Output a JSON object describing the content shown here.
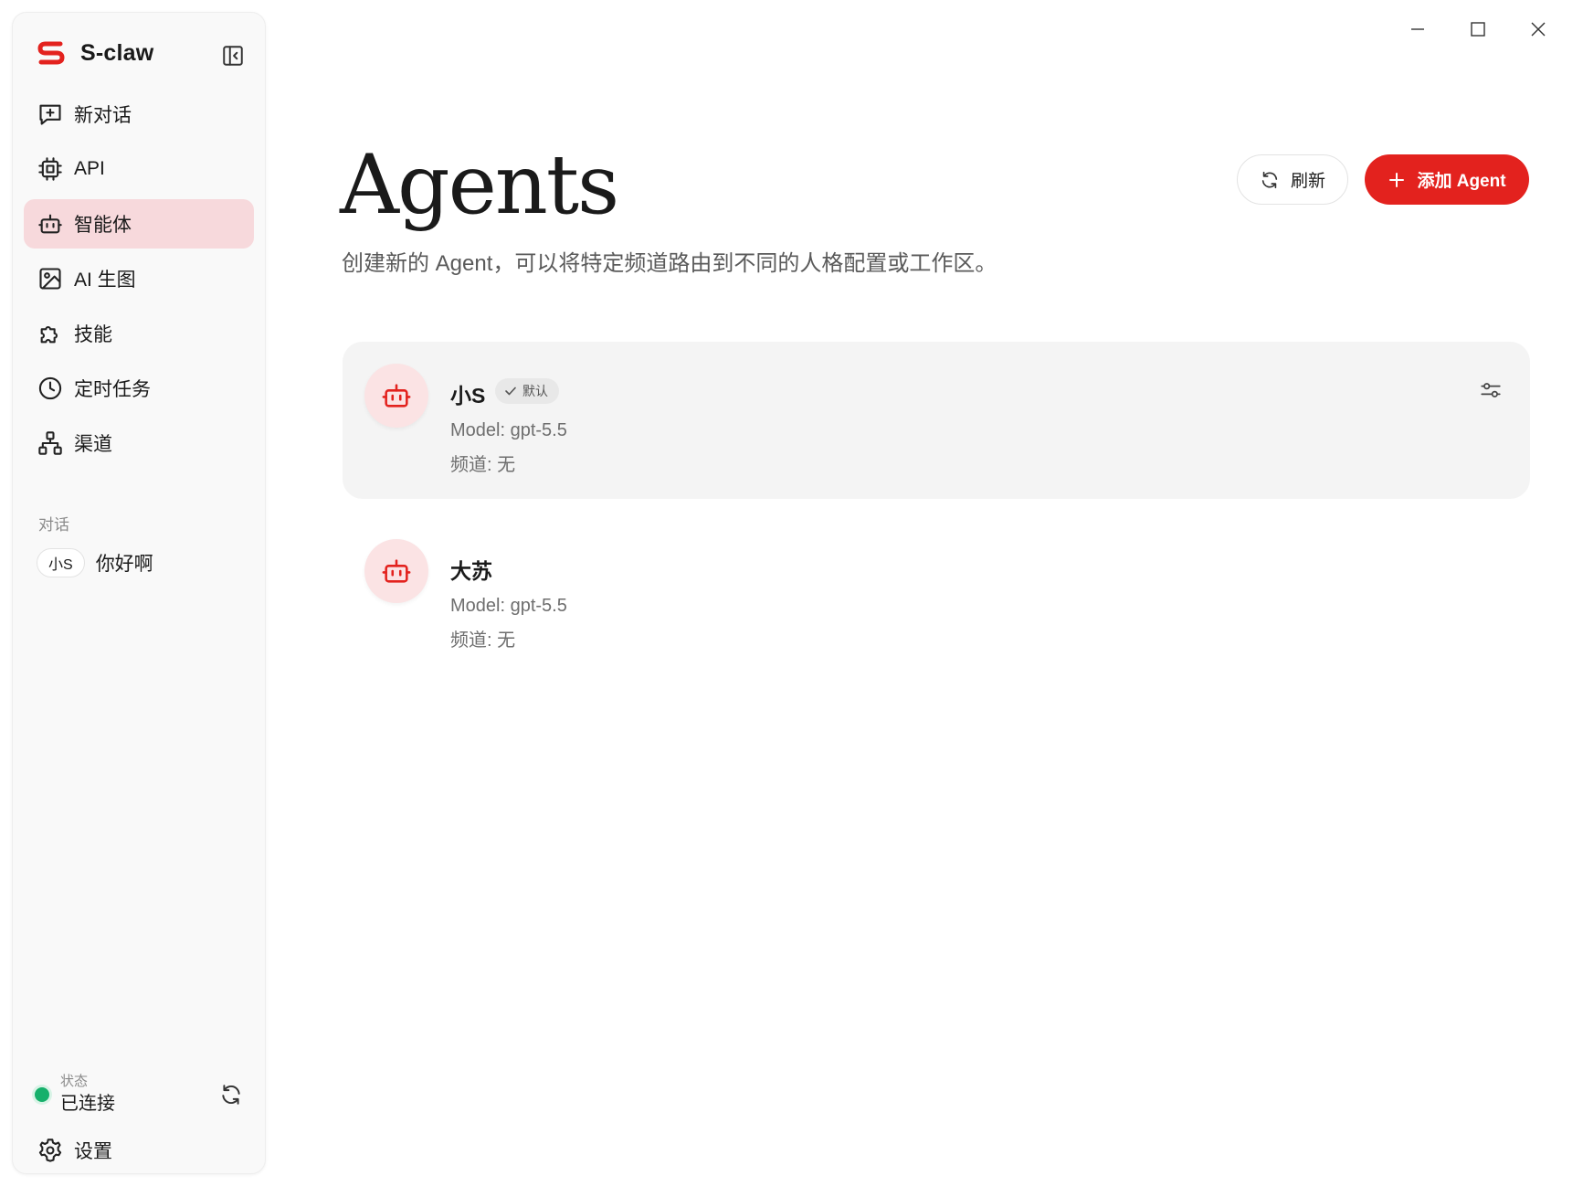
{
  "app": {
    "name": "S-claw",
    "accent_color": "#e3221e"
  },
  "sidebar": {
    "items": [
      {
        "label": "新对话",
        "icon": "new-chat-icon",
        "active": false
      },
      {
        "label": "API",
        "icon": "chip-icon",
        "active": false
      },
      {
        "label": "智能体",
        "icon": "robot-icon",
        "active": true
      },
      {
        "label": "AI 生图",
        "icon": "image-icon",
        "active": false
      },
      {
        "label": "技能",
        "icon": "puzzle-icon",
        "active": false
      },
      {
        "label": "定时任务",
        "icon": "clock-icon",
        "active": false
      },
      {
        "label": "渠道",
        "icon": "sitemap-icon",
        "active": false
      }
    ],
    "section_label": "对话",
    "conversations": [
      {
        "agent": "小S",
        "title": "你好啊"
      }
    ],
    "status": {
      "label": "状态",
      "value": "已连接",
      "color": "#16b06b"
    },
    "settings_label": "设置"
  },
  "main": {
    "title": "Agents",
    "description": "创建新的 Agent，可以将特定频道路由到不同的人格配置或工作区。",
    "refresh_label": "刷新",
    "add_label": "添加 Agent",
    "agents": [
      {
        "name": "小S",
        "badge": "默认",
        "model": "Model: gpt-5.5",
        "channel": "频道: 无",
        "selected": true
      },
      {
        "name": "大苏",
        "badge": "",
        "model": "Model: gpt-5.5",
        "channel": "频道: 无",
        "selected": false
      }
    ]
  }
}
